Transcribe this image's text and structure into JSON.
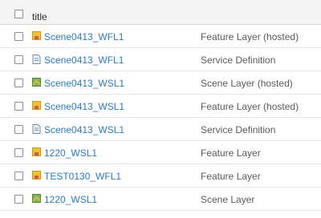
{
  "header": {
    "title_label": "title"
  },
  "rows": [
    {
      "title": "Scene0413_WFL1",
      "type": "Feature Layer (hosted)",
      "icon": "feature-layer-icon"
    },
    {
      "title": "Scene0413_WFL1",
      "type": "Service Definition",
      "icon": "service-definition-icon"
    },
    {
      "title": "Scene0413_WSL1",
      "type": "Scene Layer (hosted)",
      "icon": "scene-layer-icon"
    },
    {
      "title": "Scene0413_WSL1",
      "type": "Feature Layer (hosted)",
      "icon": "feature-layer-icon"
    },
    {
      "title": "Scene0413_WSL1",
      "type": "Service Definition",
      "icon": "service-definition-icon"
    },
    {
      "title": "1220_WSL1",
      "type": "Feature Layer",
      "icon": "feature-layer-icon"
    },
    {
      "title": "TEST0130_WFL1",
      "type": "Feature Layer",
      "icon": "feature-layer-icon"
    },
    {
      "title": "1220_WSL1",
      "type": "Scene Layer",
      "icon": "scene-layer-icon"
    }
  ],
  "colors": {
    "link": "#2a7bc2",
    "header_bg": "#f4f4f4",
    "text": "#5a5a5a"
  }
}
